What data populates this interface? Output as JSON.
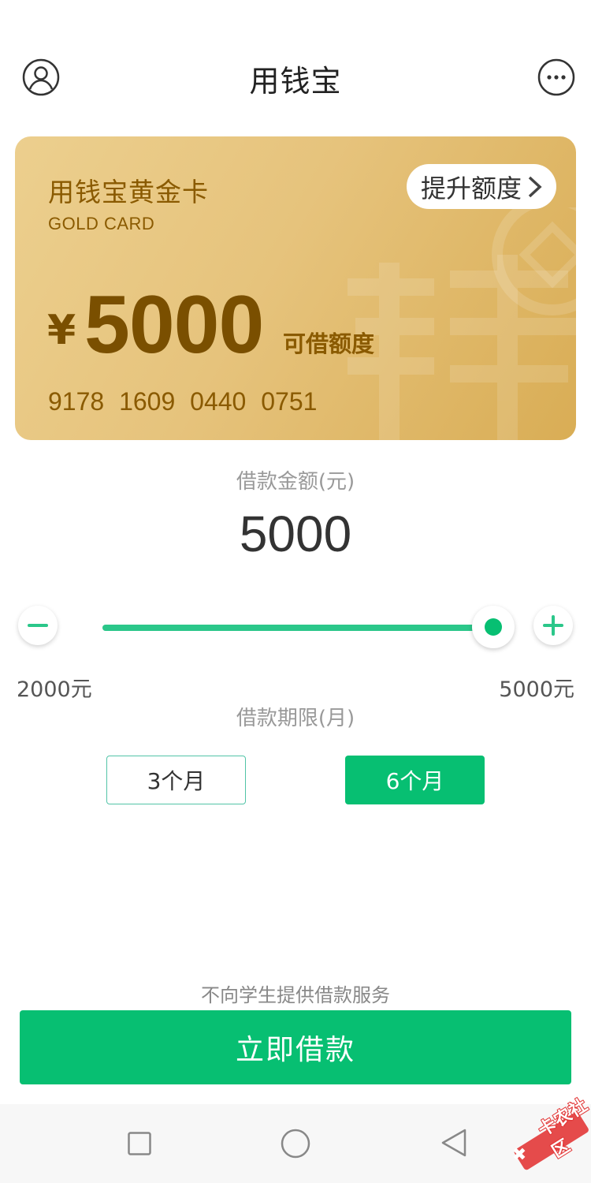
{
  "header": {
    "title": "用钱宝",
    "left_icon": "user-icon",
    "right_icon": "more-icon"
  },
  "card": {
    "name": "用钱宝黄金卡",
    "subtitle": "GOLD CARD",
    "raise_label": "提升额度",
    "currency": "¥",
    "amount": "5000",
    "amount_label": "可借额度",
    "card_number": "9178 1609 0440 0751",
    "colors": {
      "gradient_start": "#eccf8e",
      "gradient_end": "#d9ad55",
      "text": "#8a5a00"
    }
  },
  "loan": {
    "label": "借款金额(元)",
    "value": "5000",
    "min_label": "2000元",
    "max_label": "5000元",
    "slider_level": 1.0,
    "accent": "#07bf72"
  },
  "term": {
    "label": "借款期限(月)",
    "options": [
      {
        "label": "3个月",
        "selected": false
      },
      {
        "label": "6个月",
        "selected": true
      }
    ]
  },
  "footer": {
    "notice": "不向学生提供借款服务",
    "button_label": "立即借款"
  },
  "system_nav": {
    "icons": [
      "recent-apps-icon",
      "home-icon",
      "back-icon"
    ]
  },
  "watermark": {
    "text": "卡农社区"
  }
}
